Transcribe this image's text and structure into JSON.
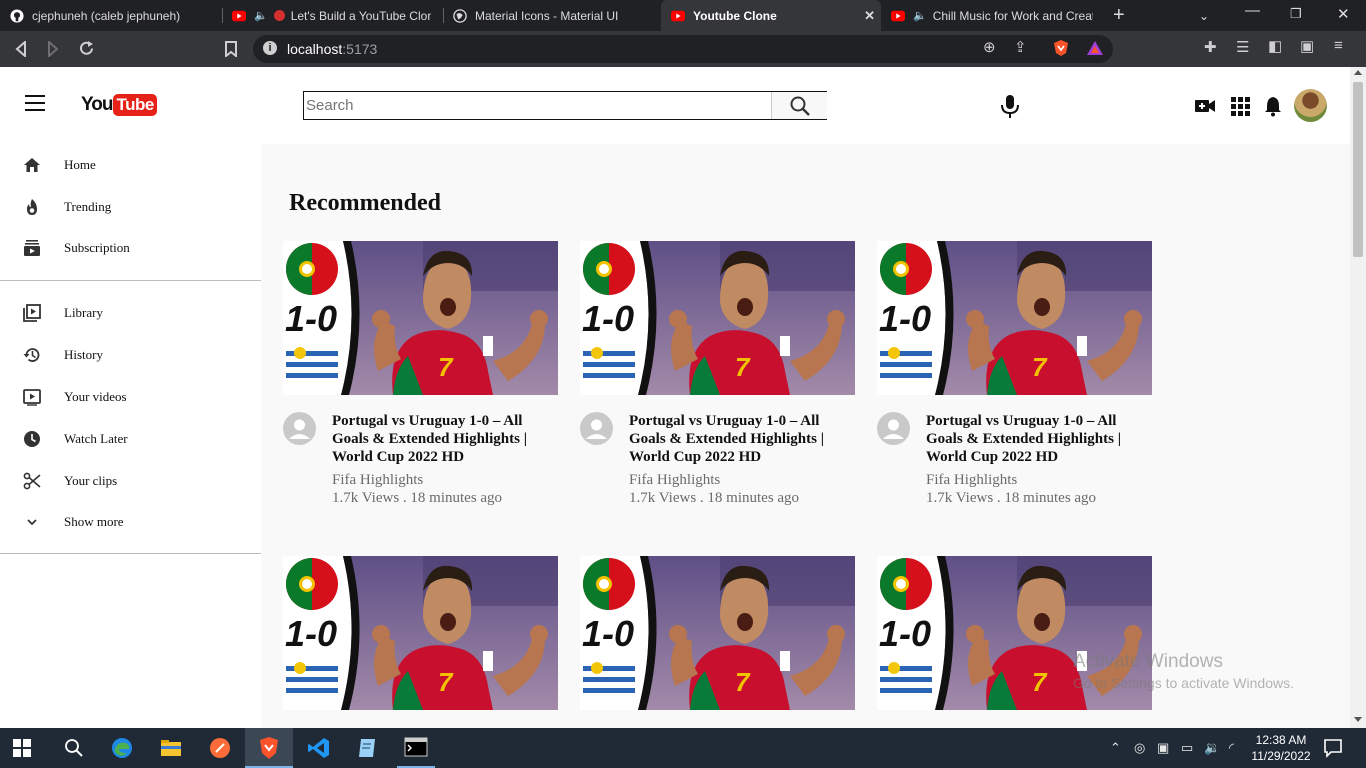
{
  "browser": {
    "tabs": [
      {
        "title": "cjephuneh (caleb jephuneh)",
        "icon": "github-icon",
        "active": false
      },
      {
        "title": "Let's Build a YouTube Clone",
        "icon": "youtube-icon",
        "active": false
      },
      {
        "title": "Material Icons - Material UI",
        "icon": "globe-icon",
        "active": false
      },
      {
        "title": "Youtube Clone",
        "icon": "youtube-icon",
        "active": true
      },
      {
        "title": "Chill Music for Work and Creat",
        "icon": "youtube-icon",
        "active": false
      }
    ],
    "url_host": "localhost",
    "url_port": ":5173"
  },
  "header": {
    "logo_you": "You",
    "logo_tube": "Tube",
    "search_placeholder": "Search"
  },
  "sidebar": {
    "group1": [
      {
        "label": "Home",
        "icon": "home-icon"
      },
      {
        "label": "Trending",
        "icon": "fire-icon"
      },
      {
        "label": "Subscription",
        "icon": "subscriptions-icon"
      }
    ],
    "group2": [
      {
        "label": "Library",
        "icon": "video-library-icon"
      },
      {
        "label": "History",
        "icon": "history-icon"
      },
      {
        "label": "Your videos",
        "icon": "video-play-icon"
      },
      {
        "label": "Watch Later",
        "icon": "clock-icon"
      },
      {
        "label": "Your clips",
        "icon": "scissors-icon"
      },
      {
        "label": "Show more",
        "icon": "chevron-down-icon"
      }
    ]
  },
  "main": {
    "section_title": "Recommended",
    "videos": [
      {
        "title": "Portugal vs Uruguay 1-0 – All Goals & Extended Highlights | World Cup 2022 HD",
        "channel": "Fifa Highlights",
        "meta": "1.7k Views . 18 minutes ago",
        "score": "1-0"
      },
      {
        "title": "Portugal vs Uruguay 1-0 – All Goals & Extended Highlights | World Cup 2022 HD",
        "channel": "Fifa Highlights",
        "meta": "1.7k Views . 18 minutes ago",
        "score": "1-0"
      },
      {
        "title": "Portugal vs Uruguay 1-0 – All Goals & Extended Highlights | World Cup 2022 HD",
        "channel": "Fifa Highlights",
        "meta": "1.7k Views . 18 minutes ago",
        "score": "1-0"
      },
      {
        "title": "",
        "channel": "",
        "meta": "",
        "score": "1-0"
      },
      {
        "title": "",
        "channel": "",
        "meta": "",
        "score": "1-0"
      },
      {
        "title": "",
        "channel": "",
        "meta": "",
        "score": "1-0"
      }
    ]
  },
  "watermark": {
    "line1": "Activate Windows",
    "line2": "Go to Settings to activate Windows."
  },
  "taskbar": {
    "time": "12:38 AM",
    "date": "11/29/2022"
  }
}
